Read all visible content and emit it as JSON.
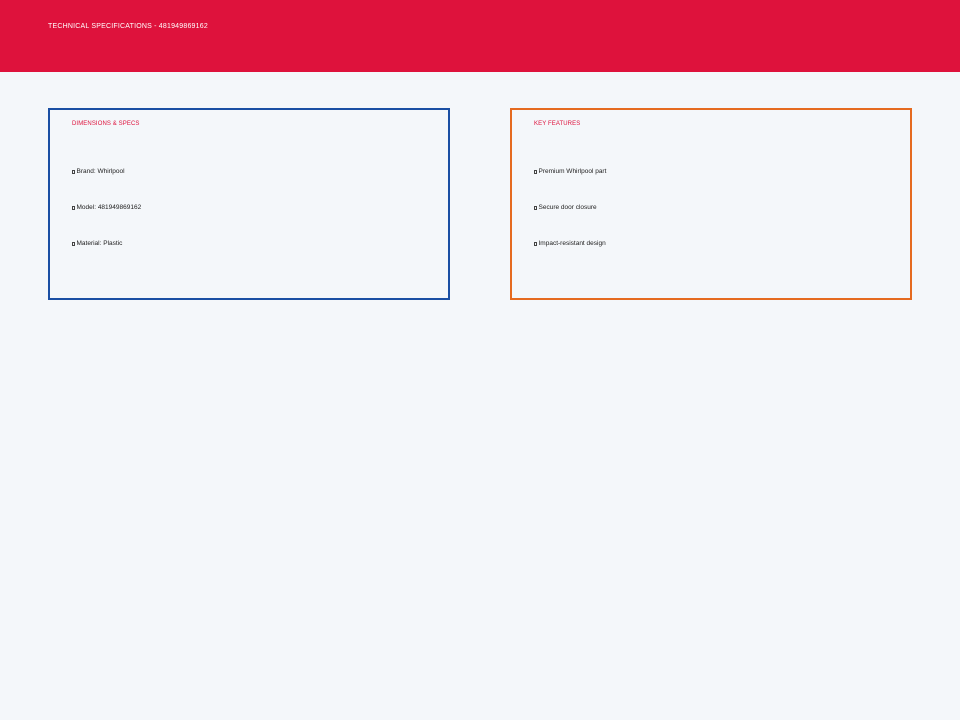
{
  "header": {
    "title": "TECHNICAL SPECIFICATIONS - 481949869162",
    "background_color": "#de123c"
  },
  "specs_card": {
    "title": "DIMENSIONS & SPECS",
    "border_color": "#1a4fa3",
    "items": [
      {
        "label": "Brand: Whirlpool"
      },
      {
        "label": "Model: 481949869162"
      },
      {
        "label": "Material: Plastic"
      }
    ]
  },
  "features_card": {
    "title": "KEY FEATURES",
    "border_color": "#e56a1f",
    "items": [
      {
        "label": "Premium Whirlpool part"
      },
      {
        "label": "Secure door closure"
      },
      {
        "label": "Impact-resistant design"
      }
    ]
  },
  "colors": {
    "accent": "#de123c",
    "page_background": "#f4f7fa",
    "text": "#222222"
  },
  "icons": {
    "bullet": "bullet-icon"
  }
}
